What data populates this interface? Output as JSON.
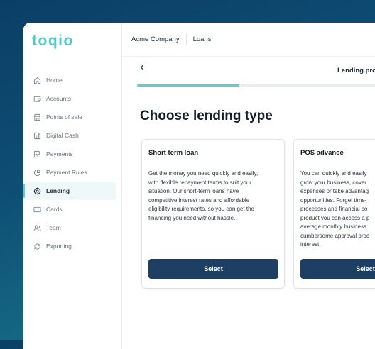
{
  "brand": {
    "logo_text": "toqio"
  },
  "sidebar": {
    "items": [
      {
        "label": "Home",
        "icon": "home-icon",
        "active": false
      },
      {
        "label": "Accounts",
        "icon": "wallet-icon",
        "active": false
      },
      {
        "label": "Points of sale",
        "icon": "store-icon",
        "active": false
      },
      {
        "label": "Digital Cash",
        "icon": "cash-icon",
        "active": false
      },
      {
        "label": "Payments",
        "icon": "payments-icon",
        "active": false
      },
      {
        "label": "Payment Rules",
        "icon": "pie-chart-icon",
        "active": false
      },
      {
        "label": "Lending",
        "icon": "lending-icon",
        "active": true
      },
      {
        "label": "Cards",
        "icon": "card-icon",
        "active": false
      },
      {
        "label": "Team",
        "icon": "team-icon",
        "active": false
      },
      {
        "label": "Exporting",
        "icon": "refresh-icon",
        "active": false
      }
    ]
  },
  "topbar": {
    "company": "Acme Company",
    "section": "Loans"
  },
  "wizard": {
    "step_title": "Lending pro",
    "progress_fraction": 0.4
  },
  "main": {
    "title": "Choose lending type",
    "cards": [
      {
        "title": "Short term loan",
        "description_lines": [
          "Get the money you need quickly and easily,",
          "with flexible repayment terms to suit your",
          "situation. Our short-term loans have",
          "competitive interest rates and affordable",
          "eligibility requirements, so you can get the",
          "financing you need without hassle."
        ],
        "button_label": "Select"
      },
      {
        "title": "POS advance",
        "description_lines": [
          "You can quickly and easily",
          "grow your business, cover",
          "expenses or take advantag",
          "opportunities. Forget time-",
          "processes and financial co",
          "product you can access a p",
          "average monthly business",
          "cumbersome approval proc",
          "interest."
        ],
        "button_label": "Select"
      }
    ]
  },
  "colors": {
    "accent_teal": "#5ccfcf",
    "primary_button": "#1d3f63",
    "background_gradient_start": "#0b3f66",
    "background_gradient_end": "#1a7d8f"
  }
}
